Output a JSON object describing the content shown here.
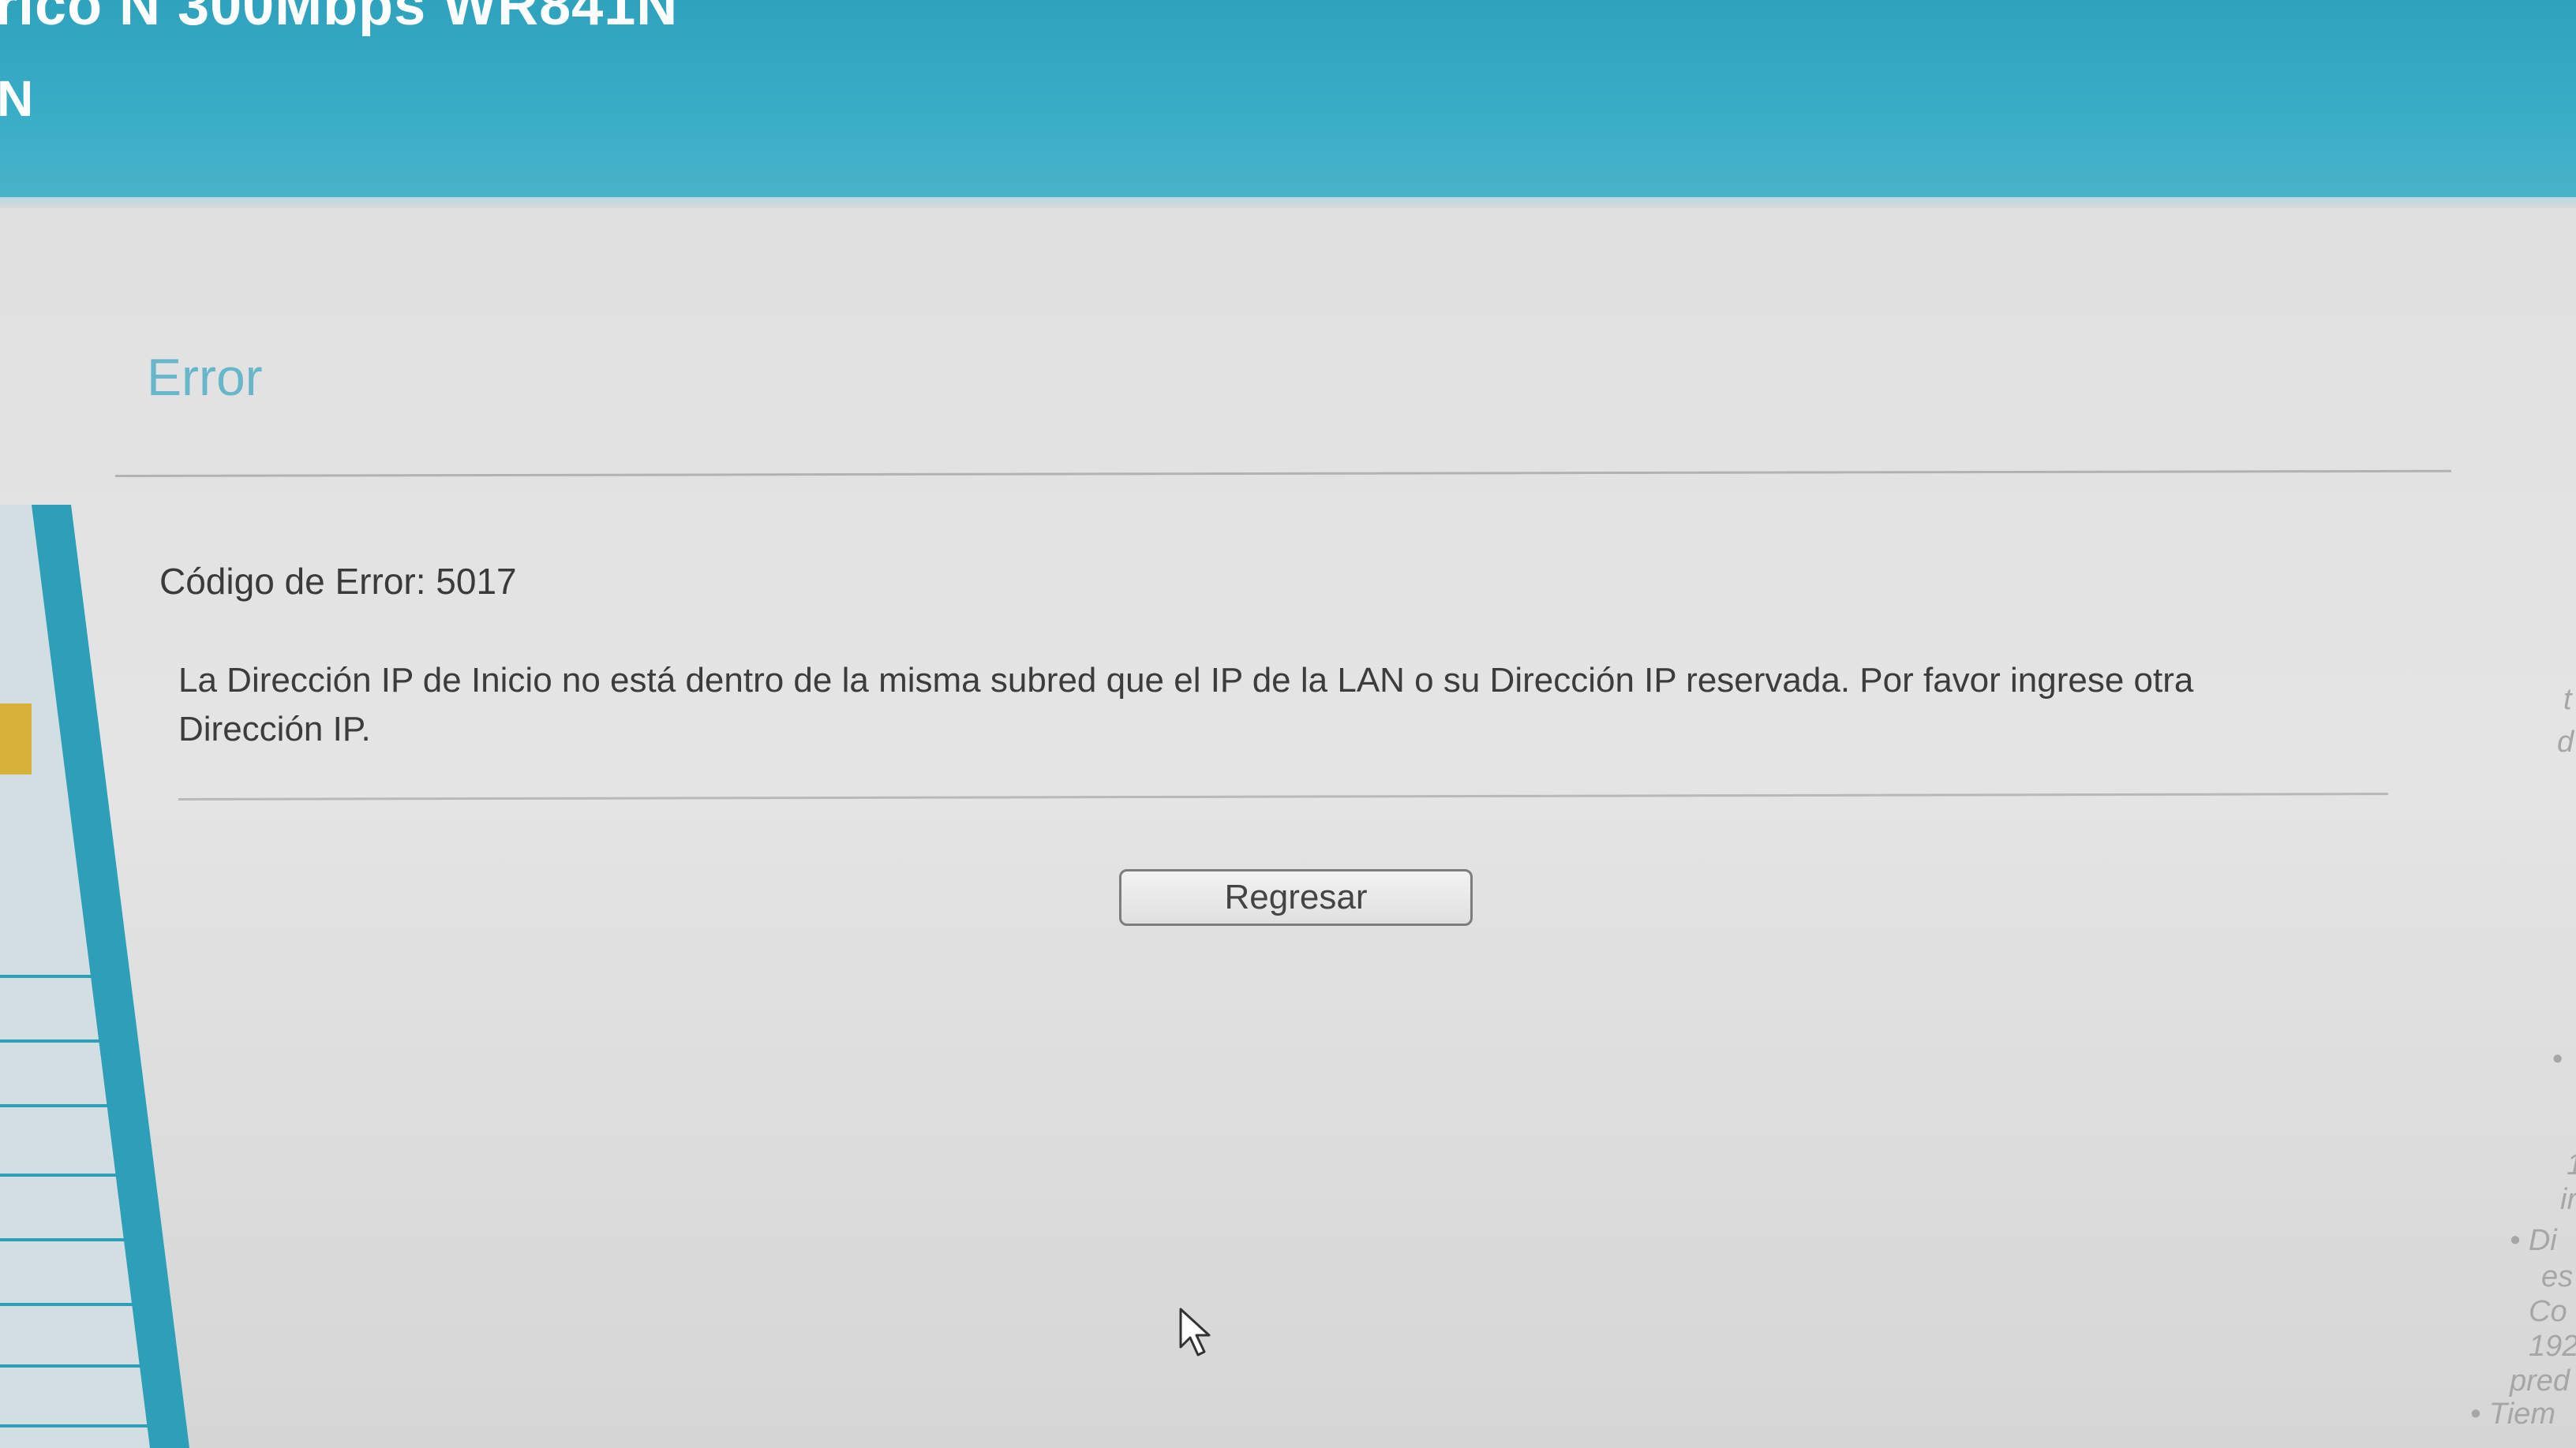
{
  "header": {
    "title": "rico N 300Mbps WR841N",
    "subtitle": "N"
  },
  "main": {
    "heading": "Error",
    "error_code_label": "Código de Error: 5017",
    "message": "La Dirección IP de Inicio no está dentro de la misma subred que el IP de la LAN o su Dirección IP reservada. Por favor ingrese otra Dirección IP.",
    "back_button_label": "Regresar"
  },
  "help_panel": {
    "fragments": [
      "t",
      "d",
      "•",
      "1",
      "ir",
      "• Di",
      "es",
      "Co",
      "192",
      "pred",
      "• Tiem"
    ]
  },
  "colors": {
    "header_bg": "#3aaec7",
    "heading_text": "#67b6ca",
    "body_text": "#3c3c3c"
  }
}
